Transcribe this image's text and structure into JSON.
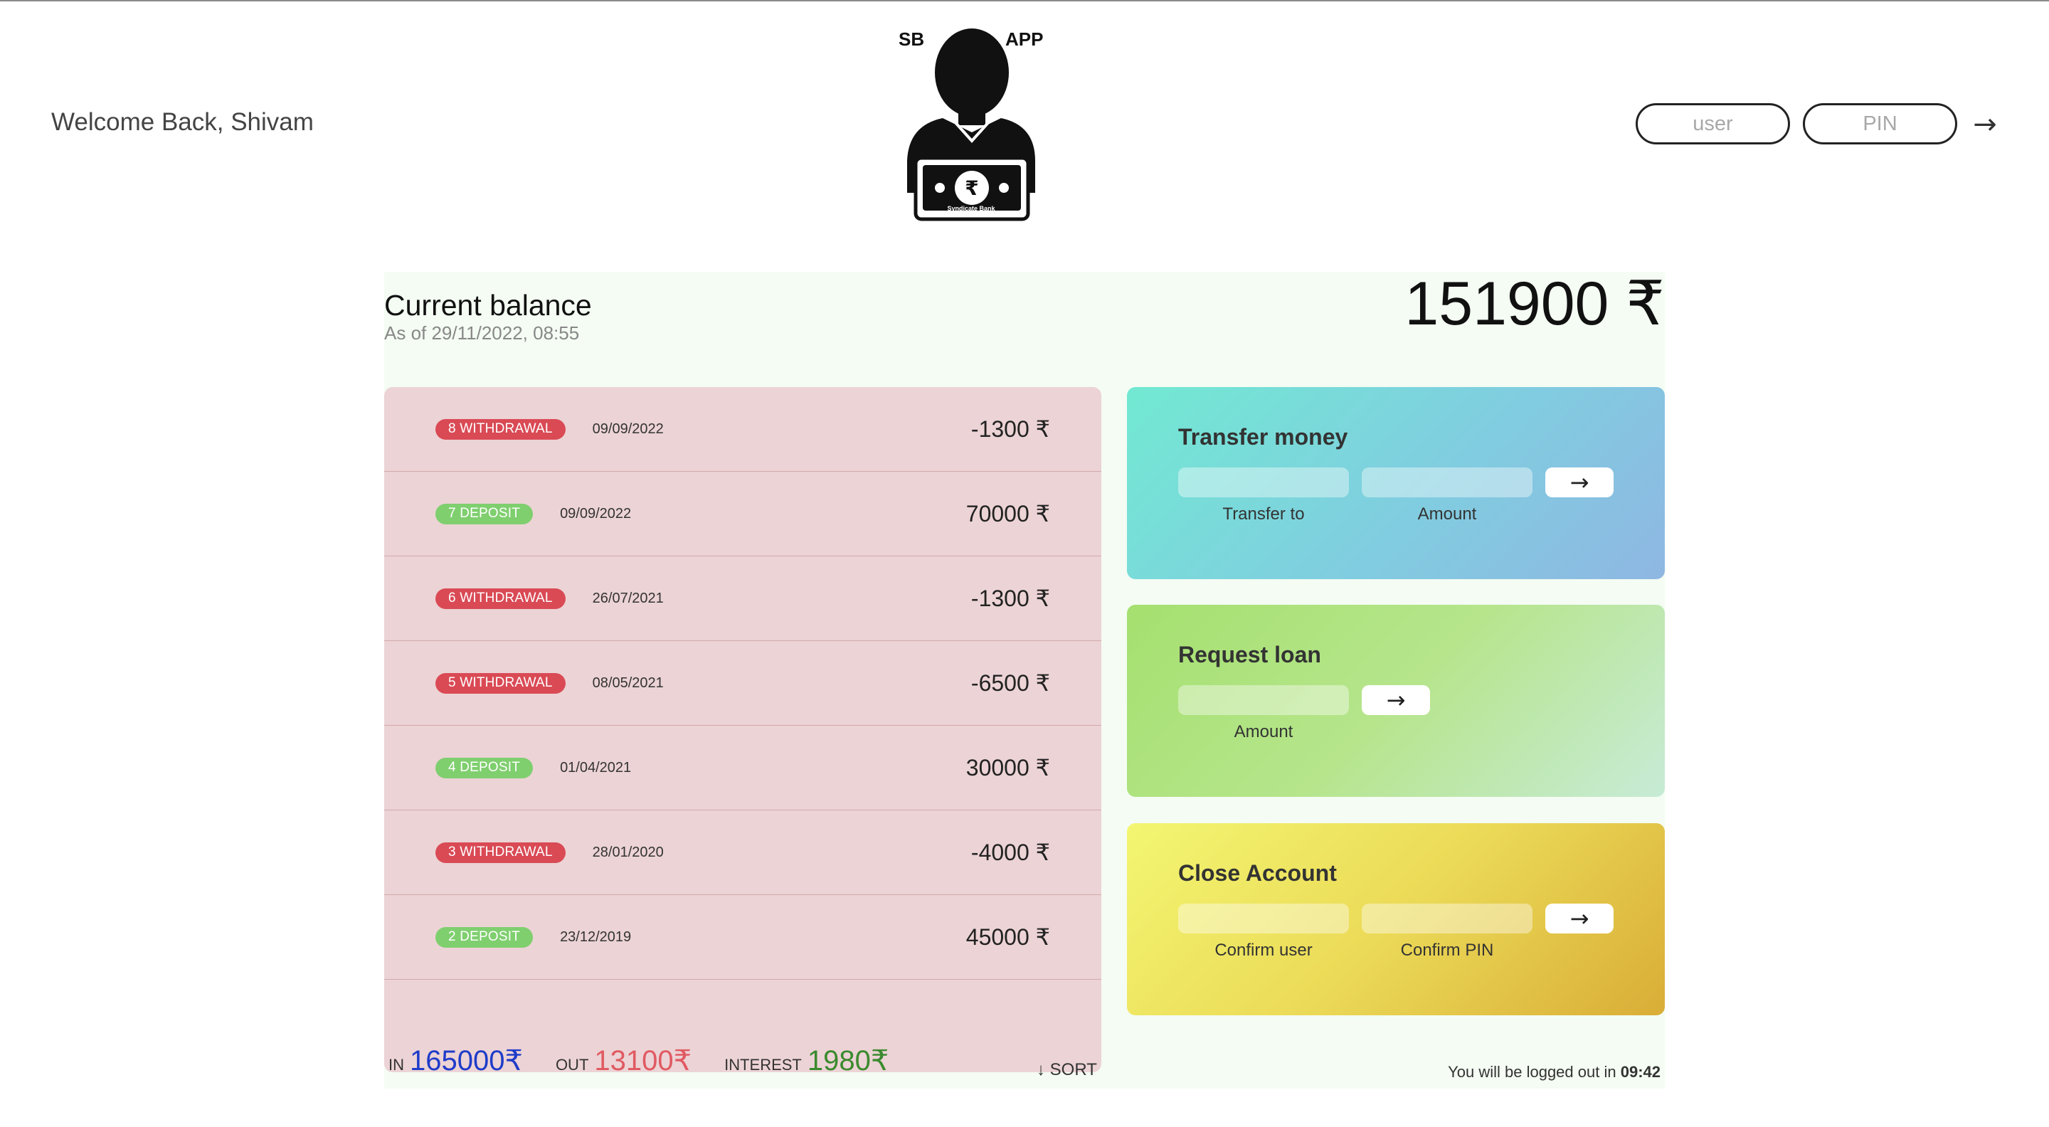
{
  "nav": {
    "welcome": "Welcome Back, Shivam",
    "logo_left": "SB",
    "logo_right": "APP",
    "logo_bank": "Syndicate Bank",
    "logo_icon": "banker-with-rupee-note-icon",
    "user_placeholder": "user",
    "pin_placeholder": "PIN",
    "login_arrow": "→"
  },
  "balance": {
    "title": "Current balance",
    "date": "As of 29/11/2022, 08:55",
    "value": "151900 ₹"
  },
  "movements": [
    {
      "type": "8 WITHDRAWAL",
      "kind": "withdrawal",
      "date": "09/09/2022",
      "value": "-1300 ₹"
    },
    {
      "type": "7 DEPOSIT",
      "kind": "deposit",
      "date": "09/09/2022",
      "value": "70000 ₹"
    },
    {
      "type": "6 WITHDRAWAL",
      "kind": "withdrawal",
      "date": "26/07/2021",
      "value": "-1300 ₹"
    },
    {
      "type": "5 WITHDRAWAL",
      "kind": "withdrawal",
      "date": "08/05/2021",
      "value": "-6500 ₹"
    },
    {
      "type": "4 DEPOSIT",
      "kind": "deposit",
      "date": "01/04/2021",
      "value": "30000 ₹"
    },
    {
      "type": "3 WITHDRAWAL",
      "kind": "withdrawal",
      "date": "28/01/2020",
      "value": "-4000 ₹"
    },
    {
      "type": "2 DEPOSIT",
      "kind": "deposit",
      "date": "23/12/2019",
      "value": "45000 ₹"
    }
  ],
  "operations": {
    "transfer": {
      "title": "Transfer money",
      "to_label": "Transfer to",
      "amount_label": "Amount",
      "button": "→"
    },
    "loan": {
      "title": "Request loan",
      "amount_label": "Amount",
      "button": "→"
    },
    "close": {
      "title": "Close Account",
      "user_label": "Confirm user",
      "pin_label": "Confirm PIN",
      "button": "→"
    }
  },
  "summary": {
    "in_label": "In",
    "in_value": "165000₹",
    "out_label": "Out",
    "out_value": "13100₹",
    "interest_label": "Interest",
    "interest_value": "1980₹",
    "sort_label": "↓ SORT"
  },
  "logout": {
    "text": "You will be logged out in",
    "timer": "09:42"
  },
  "colors": {
    "withdrawal": "#d94a55",
    "deposit": "#7fcf6f",
    "in": "#1f3cc9",
    "out": "#e05a62",
    "interest": "#3b8a2e"
  }
}
